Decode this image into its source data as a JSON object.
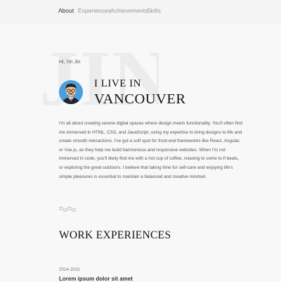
{
  "nav": {
    "items": [
      {
        "label": "About",
        "active": true
      },
      {
        "label": "Experiences",
        "active": false
      },
      {
        "label": "Achievements",
        "active": false
      },
      {
        "label": "Skills",
        "active": false
      }
    ]
  },
  "hero": {
    "initials": "JIN",
    "greeting": "Hi, I'm Jin",
    "line1": "I LIVE IN",
    "line2": "VANCOUVER",
    "avatar_icon": "avatar-icon"
  },
  "bio": "I'm all about creating serene digital spaces where design meets functionality. You'll often find me immersed in HTML, CSS, and JavaScript, using my expertise to bring designs to life and create smooth interactions. I've got a soft spot for front-end frameworks like React, Angular, or Vue.js, as they help me build harmonious and responsive websites. When I'm not immersed in code, you'll likely find me with a hot cup of coffee, relaxing to some lo-fi beats, or exploring the great outdoors. I believe that taking time for self-care and enjoying life's simple pleasures is essential to maintain a balanced and creative mindset.",
  "work": {
    "title": "WORK EXPERIENCES",
    "items": [
      {
        "date": "2014-2015",
        "title": "Lorem ipsum dolor sit amet"
      }
    ]
  },
  "colors": {
    "background": "#f8f8f8",
    "navbar": "#f4f4f4",
    "avatar_circle": "#4a9fe0",
    "watermark": "#ececec"
  }
}
